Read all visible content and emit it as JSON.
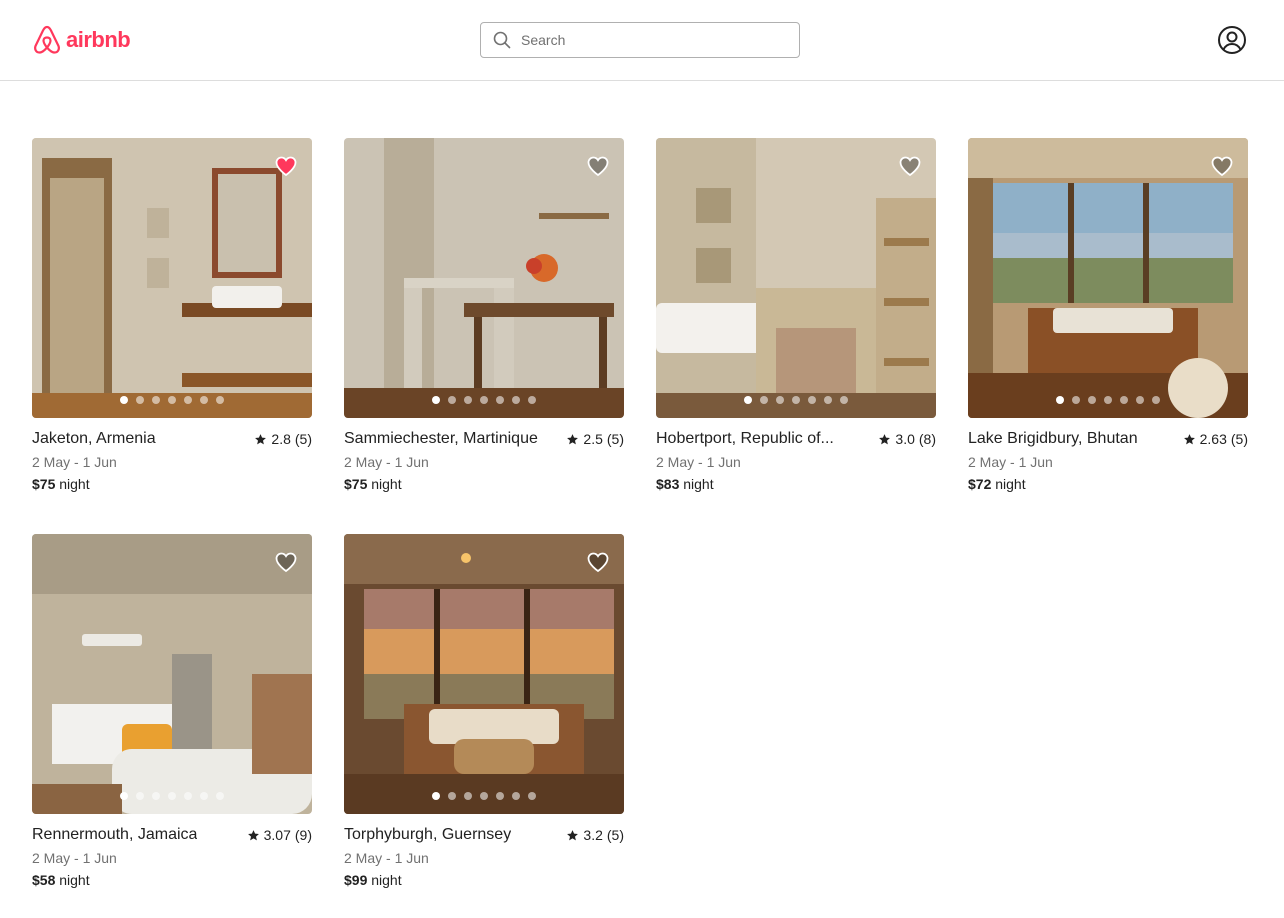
{
  "brand": {
    "name": "airbnb",
    "color": "#ff385c"
  },
  "search": {
    "placeholder": "Search"
  },
  "listings": [
    {
      "location": "Jaketon, Armenia",
      "rating": "2.8",
      "reviews": "(5)",
      "dates": "2 May - 1 Jun",
      "price": "$75",
      "unit": "night",
      "favorited": true,
      "photo_count": 7,
      "active_photo": 1
    },
    {
      "location": "Sammiechester, Martinique",
      "rating": "2.5",
      "reviews": "(5)",
      "dates": "2 May - 1 Jun",
      "price": "$75",
      "unit": "night",
      "favorited": false,
      "photo_count": 7,
      "active_photo": 1
    },
    {
      "location": "Hobertport, Republic of...",
      "rating": "3.0",
      "reviews": "(8)",
      "dates": "2 May - 1 Jun",
      "price": "$83",
      "unit": "night",
      "favorited": false,
      "photo_count": 7,
      "active_photo": 1
    },
    {
      "location": "Lake Brigidbury, Bhutan",
      "rating": "2.63",
      "reviews": "(5)",
      "dates": "2 May - 1 Jun",
      "price": "$72",
      "unit": "night",
      "favorited": false,
      "photo_count": 7,
      "active_photo": 1
    },
    {
      "location": "Rennermouth, Jamaica",
      "rating": "3.07",
      "reviews": "(9)",
      "dates": "2 May - 1 Jun",
      "price": "$58",
      "unit": "night",
      "favorited": false,
      "photo_count": 7,
      "active_photo": 1
    },
    {
      "location": "Torphyburgh, Guernsey",
      "rating": "3.2",
      "reviews": "(5)",
      "dates": "2 May - 1 Jun",
      "price": "$99",
      "unit": "night",
      "favorited": false,
      "photo_count": 7,
      "active_photo": 1
    }
  ]
}
